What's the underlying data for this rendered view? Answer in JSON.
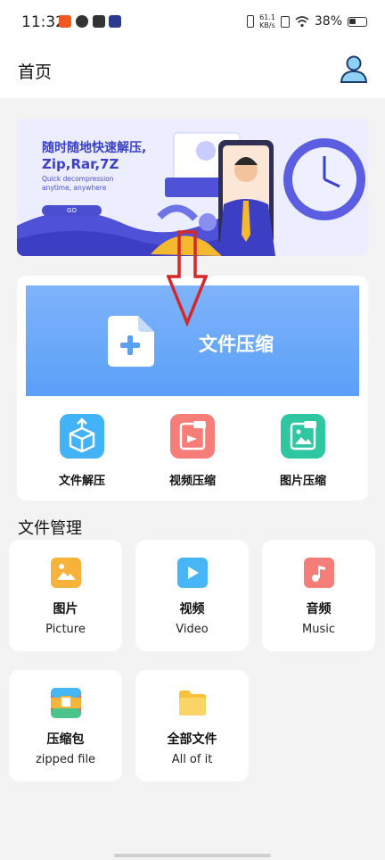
{
  "status_bar": {
    "time": "11:32",
    "net_speed_value": "61.1",
    "net_speed_unit": "KB/s",
    "battery": "38%"
  },
  "header": {
    "title": "首页",
    "user_icon": "user-icon"
  },
  "banner": {
    "title": "随时随地快速解压,",
    "formats": "Zip,Rar,7Z",
    "desc": "Quick decompression anytime, anywhere",
    "go": "GO"
  },
  "compress": {
    "label": "文件压缩",
    "icon": "add-file-icon"
  },
  "tools": [
    {
      "label": "文件解压",
      "icon": "unzip-box-icon",
      "color": "#42b3f6"
    },
    {
      "label": "视频压缩",
      "icon": "video-zip-icon",
      "color": "#f77d78"
    },
    {
      "label": "图片压缩",
      "icon": "image-zip-icon",
      "color": "#2fc7a2"
    }
  ],
  "file_management": {
    "title": "文件管理",
    "items": [
      {
        "zh": "图片",
        "en": "Picture",
        "icon": "picture-file-icon",
        "color": "#f7b23a"
      },
      {
        "zh": "视频",
        "en": "Video",
        "icon": "video-file-icon",
        "color": "#48b5f7"
      },
      {
        "zh": "音频",
        "en": "Music",
        "icon": "music-file-icon",
        "color": "#f77d78"
      },
      {
        "zh": "压缩包",
        "en": "zipped file",
        "icon": "zip-package-icon",
        "color": "#e85d5d"
      },
      {
        "zh": "全部文件",
        "en": "All of it",
        "icon": "folder-icon",
        "color": "#f8c03b"
      }
    ]
  },
  "colors": {
    "accent": "#5aa0f7",
    "annotation_arrow": "#d62828"
  }
}
